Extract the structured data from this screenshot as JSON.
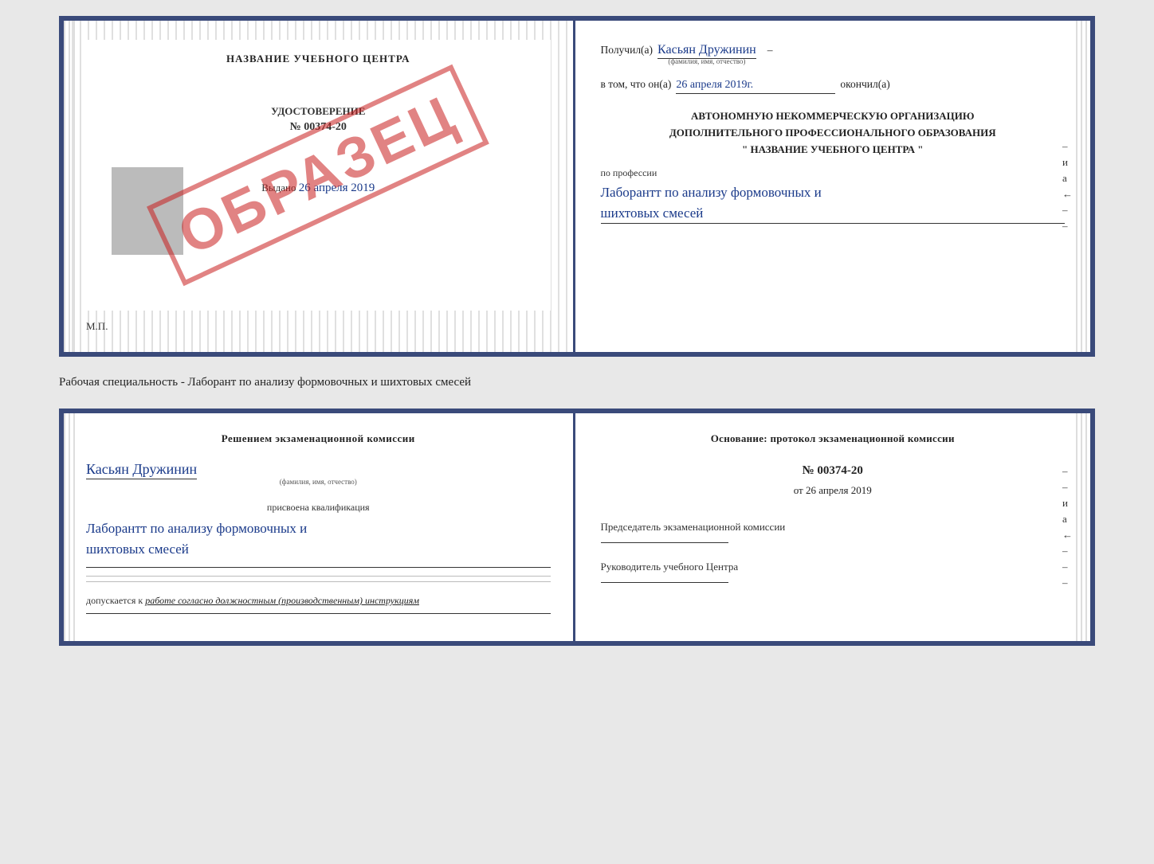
{
  "cert": {
    "left": {
      "title": "НАЗВАНИЕ УЧЕБНОГО ЦЕНТРА",
      "doc_label": "УДОСТОВЕРЕНИЕ",
      "doc_number": "№ 00374-20",
      "issued_label": "Выдано",
      "issued_date": "26 апреля 2019",
      "mp_label": "М.П.",
      "obrazec": "ОБРАЗЕЦ"
    },
    "right": {
      "received_label": "Получил(а)",
      "fio_value": "Касьян Дружинин",
      "fio_note": "(фамилия, имя, отчество)",
      "date_prefix": "в том, что он(а)",
      "date_value": "26 апреля 2019г.",
      "date_suffix": "окончил(а)",
      "org_line1": "АВТОНОМНУЮ НЕКОММЕРЧЕСКУЮ ОРГАНИЗАЦИЮ",
      "org_line2": "ДОПОЛНИТЕЛЬНОГО ПРОФЕССИОНАЛЬНОГО ОБРАЗОВАНИЯ",
      "org_line3": "\" НАЗВАНИЕ УЧЕБНОГО ЦЕНТРА \"",
      "prof_label": "по профессии",
      "prof_value_line1": "Лаборантт по анализу формовочных и",
      "prof_value_line2": "шихтовых смесей"
    }
  },
  "specialty": {
    "text": "Рабочая специальность - Лаборант по анализу формовочных и шихтовых смесей"
  },
  "qual": {
    "left": {
      "section_title": "Решением экзаменационной комиссии",
      "fio_value": "Касьян Дружинин",
      "fio_note": "(фамилия, имя, отчество)",
      "qual_label": "присвоена квалификация",
      "qual_value_line1": "Лаборантт по анализу формовочных и",
      "qual_value_line2": "шихтовых смесей",
      "допускается_label": "допускается к",
      "допускается_value": "работе согласно должностным (производственным) инструкциям"
    },
    "right": {
      "osnov_label": "Основание: протокол экзаменационной комиссии",
      "number": "№ 00374-20",
      "date_prefix": "от",
      "date_value": "26 апреля 2019",
      "chairman_label": "Председатель экзаменационной комиссии",
      "director_label": "Руководитель учебного Центра"
    }
  },
  "side_letters": [
    "и",
    "а",
    "←",
    "–",
    "–",
    "–"
  ]
}
